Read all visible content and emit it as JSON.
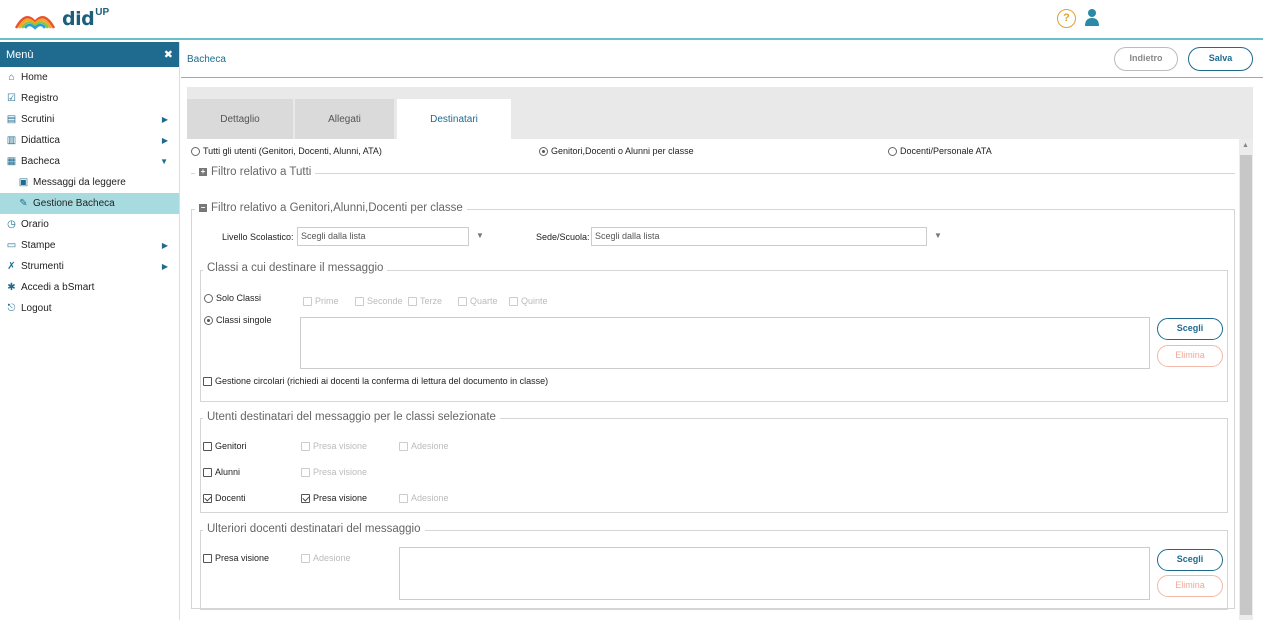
{
  "app": {
    "logo_text": "did",
    "logo_sup": "UP",
    "help_glyph": "?"
  },
  "menu": {
    "title": "Menù",
    "close_glyph": "✖",
    "items": [
      {
        "label": "Home"
      },
      {
        "label": "Registro"
      },
      {
        "label": "Scrutini"
      },
      {
        "label": "Didattica"
      },
      {
        "label": "Bacheca"
      },
      {
        "label": "Messaggi da leggere"
      },
      {
        "label": "Gestione Bacheca"
      },
      {
        "label": "Orario"
      },
      {
        "label": "Stampe"
      },
      {
        "label": "Strumenti"
      },
      {
        "label": "Accedi a bSmart"
      },
      {
        "label": "Logout"
      }
    ]
  },
  "header": {
    "title": "Bacheca",
    "back_label": "Indietro",
    "save_label": "Salva"
  },
  "tabs": [
    {
      "label": "Dettaglio"
    },
    {
      "label": "Allegati"
    },
    {
      "label": "Destinatari"
    }
  ],
  "recipients": {
    "opt_all": "Tutti gli utenti (Genitori, Docenti, Alunni, ATA)",
    "opt_class": "Genitori,Docenti o Alunni per classe",
    "opt_ata": "Docenti/Personale ATA"
  },
  "filter_all": {
    "legend": "Filtro relativo a Tutti"
  },
  "filter_class": {
    "legend": "Filtro relativo a Genitori,Alunni,Docenti per classe",
    "level_label": "Livello Scolastico:",
    "level_value": "Scegli dalla lista",
    "site_label": "Sede/Scuola:",
    "site_value": "Scegli dalla lista"
  },
  "classes": {
    "legend": "Classi a cui destinare il messaggio",
    "only_classes": "Solo Classi",
    "single_classes": "Classi singole",
    "years": [
      "Prime",
      "Seconde",
      "Terze",
      "Quarte",
      "Quinte"
    ],
    "choose": "Scegli",
    "remove": "Elimina",
    "circular": "Gestione circolari (richiedi ai docenti la conferma di lettura del documento in classe)"
  },
  "users": {
    "legend": "Utenti destinatari del messaggio per le classi selezionate",
    "parents": "Genitori",
    "students": "Alunni",
    "teachers": "Docenti",
    "seen": "Presa visione",
    "adhesion": "Adesione"
  },
  "extra": {
    "legend": "Ulteriori docenti destinatari del messaggio",
    "seen": "Presa visione",
    "adhesion": "Adesione",
    "choose": "Scegli",
    "remove": "Elimina"
  },
  "colors": {
    "accent": "#1e6b8f",
    "active_menu": "#a8dbe0",
    "help": "#e0a030"
  }
}
